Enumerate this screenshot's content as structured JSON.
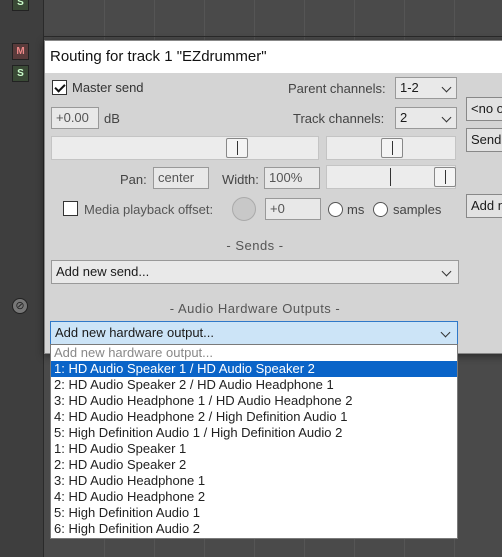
{
  "background": {
    "track_buttons": [
      {
        "label": "S"
      },
      {
        "label": "M"
      },
      {
        "label": "S"
      }
    ]
  },
  "dialog": {
    "title": "Routing for track 1 \"EZdrummer\"",
    "master_send_label": "Master send",
    "master_send_checked": true,
    "parent_channels_label": "Parent channels:",
    "parent_channels_value": "1-2",
    "track_channels_label": "Track channels:",
    "track_channels_value": "2",
    "volume_value": "+0.00",
    "volume_unit": "dB",
    "pan_label": "Pan:",
    "pan_value": "center",
    "width_label": "Width:",
    "width_value": "100%",
    "media_offset_label": "Media playback offset:",
    "media_offset_value": "+0",
    "ms_label": "ms",
    "samples_label": "samples",
    "sends_section": "- Sends -",
    "add_send_label": "Add new send...",
    "hw_section": "- Audio Hardware Outputs -",
    "hw_select_value": "Add new hardware output..."
  },
  "side_buttons": {
    "no_output": "<no o",
    "send": "Send",
    "add": "Add n"
  },
  "dropdown": {
    "items": [
      "Add new hardware output...",
      "1: HD Audio Speaker 1 / HD Audio Speaker 2",
      "2: HD Audio Speaker 2 / HD Audio Headphone 1",
      "3: HD Audio Headphone 1 / HD Audio Headphone 2",
      "4: HD Audio Headphone 2 / High Definition Audio 1",
      "5: High Definition Audio 1 / High Definition Audio 2",
      "1: HD Audio Speaker 1",
      "2: HD Audio Speaker 2",
      "3: HD Audio Headphone 1",
      "4: HD Audio Headphone 2",
      "5: High Definition Audio 1",
      "6: High Definition Audio 2"
    ],
    "selected_index": 1
  },
  "colors": {
    "selection": "#0a64c8",
    "dialog_bg": "#d4d4d4"
  }
}
